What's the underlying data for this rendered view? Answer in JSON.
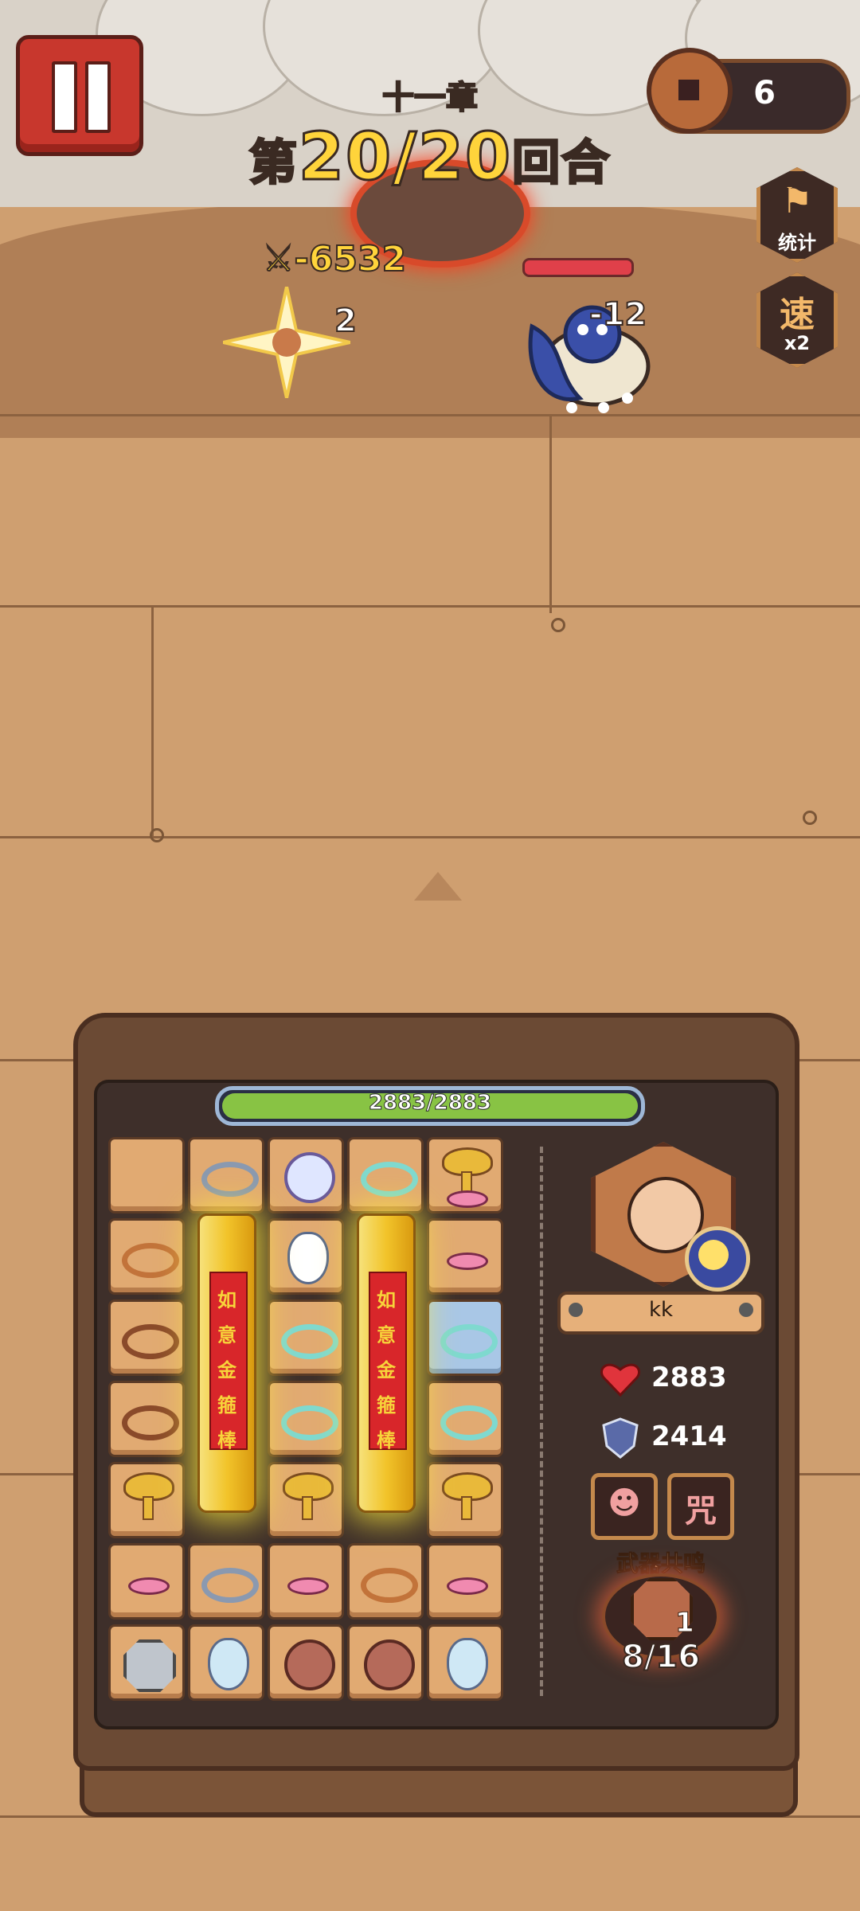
{
  "header": {
    "chapter": "十一章",
    "round_prefix": "第",
    "round_current_total": "20/20",
    "round_suffix": "回合"
  },
  "currency": {
    "coins": "6"
  },
  "side_buttons": [
    {
      "glyph": "",
      "label": "统计",
      "icon": "stats-icon"
    },
    {
      "glyph": "速",
      "label": "x2",
      "icon": "speed-icon"
    }
  ],
  "battle": {
    "damage_popup": "-6532",
    "hit_popup": "2",
    "enemy_damage": "-12",
    "enemy_hp_fraction": 1.0
  },
  "player": {
    "hp_text": "2883/2883",
    "hp_fraction": 1.0,
    "name": "kk",
    "hp": "2883",
    "defense": "2414",
    "skills": [
      {
        "name": "rage-skill",
        "glyph": ""
      },
      {
        "name": "curse-skill",
        "glyph": "咒"
      }
    ]
  },
  "weapon_resonance": {
    "label": "武器共鸣",
    "level": "1",
    "progress": "8/16"
  },
  "grid_pillar_text": "如意金箍棒",
  "colors": {
    "accent_gold": "#ffd43b",
    "hp_green": "#88c344",
    "pause_red": "#c8372d"
  }
}
